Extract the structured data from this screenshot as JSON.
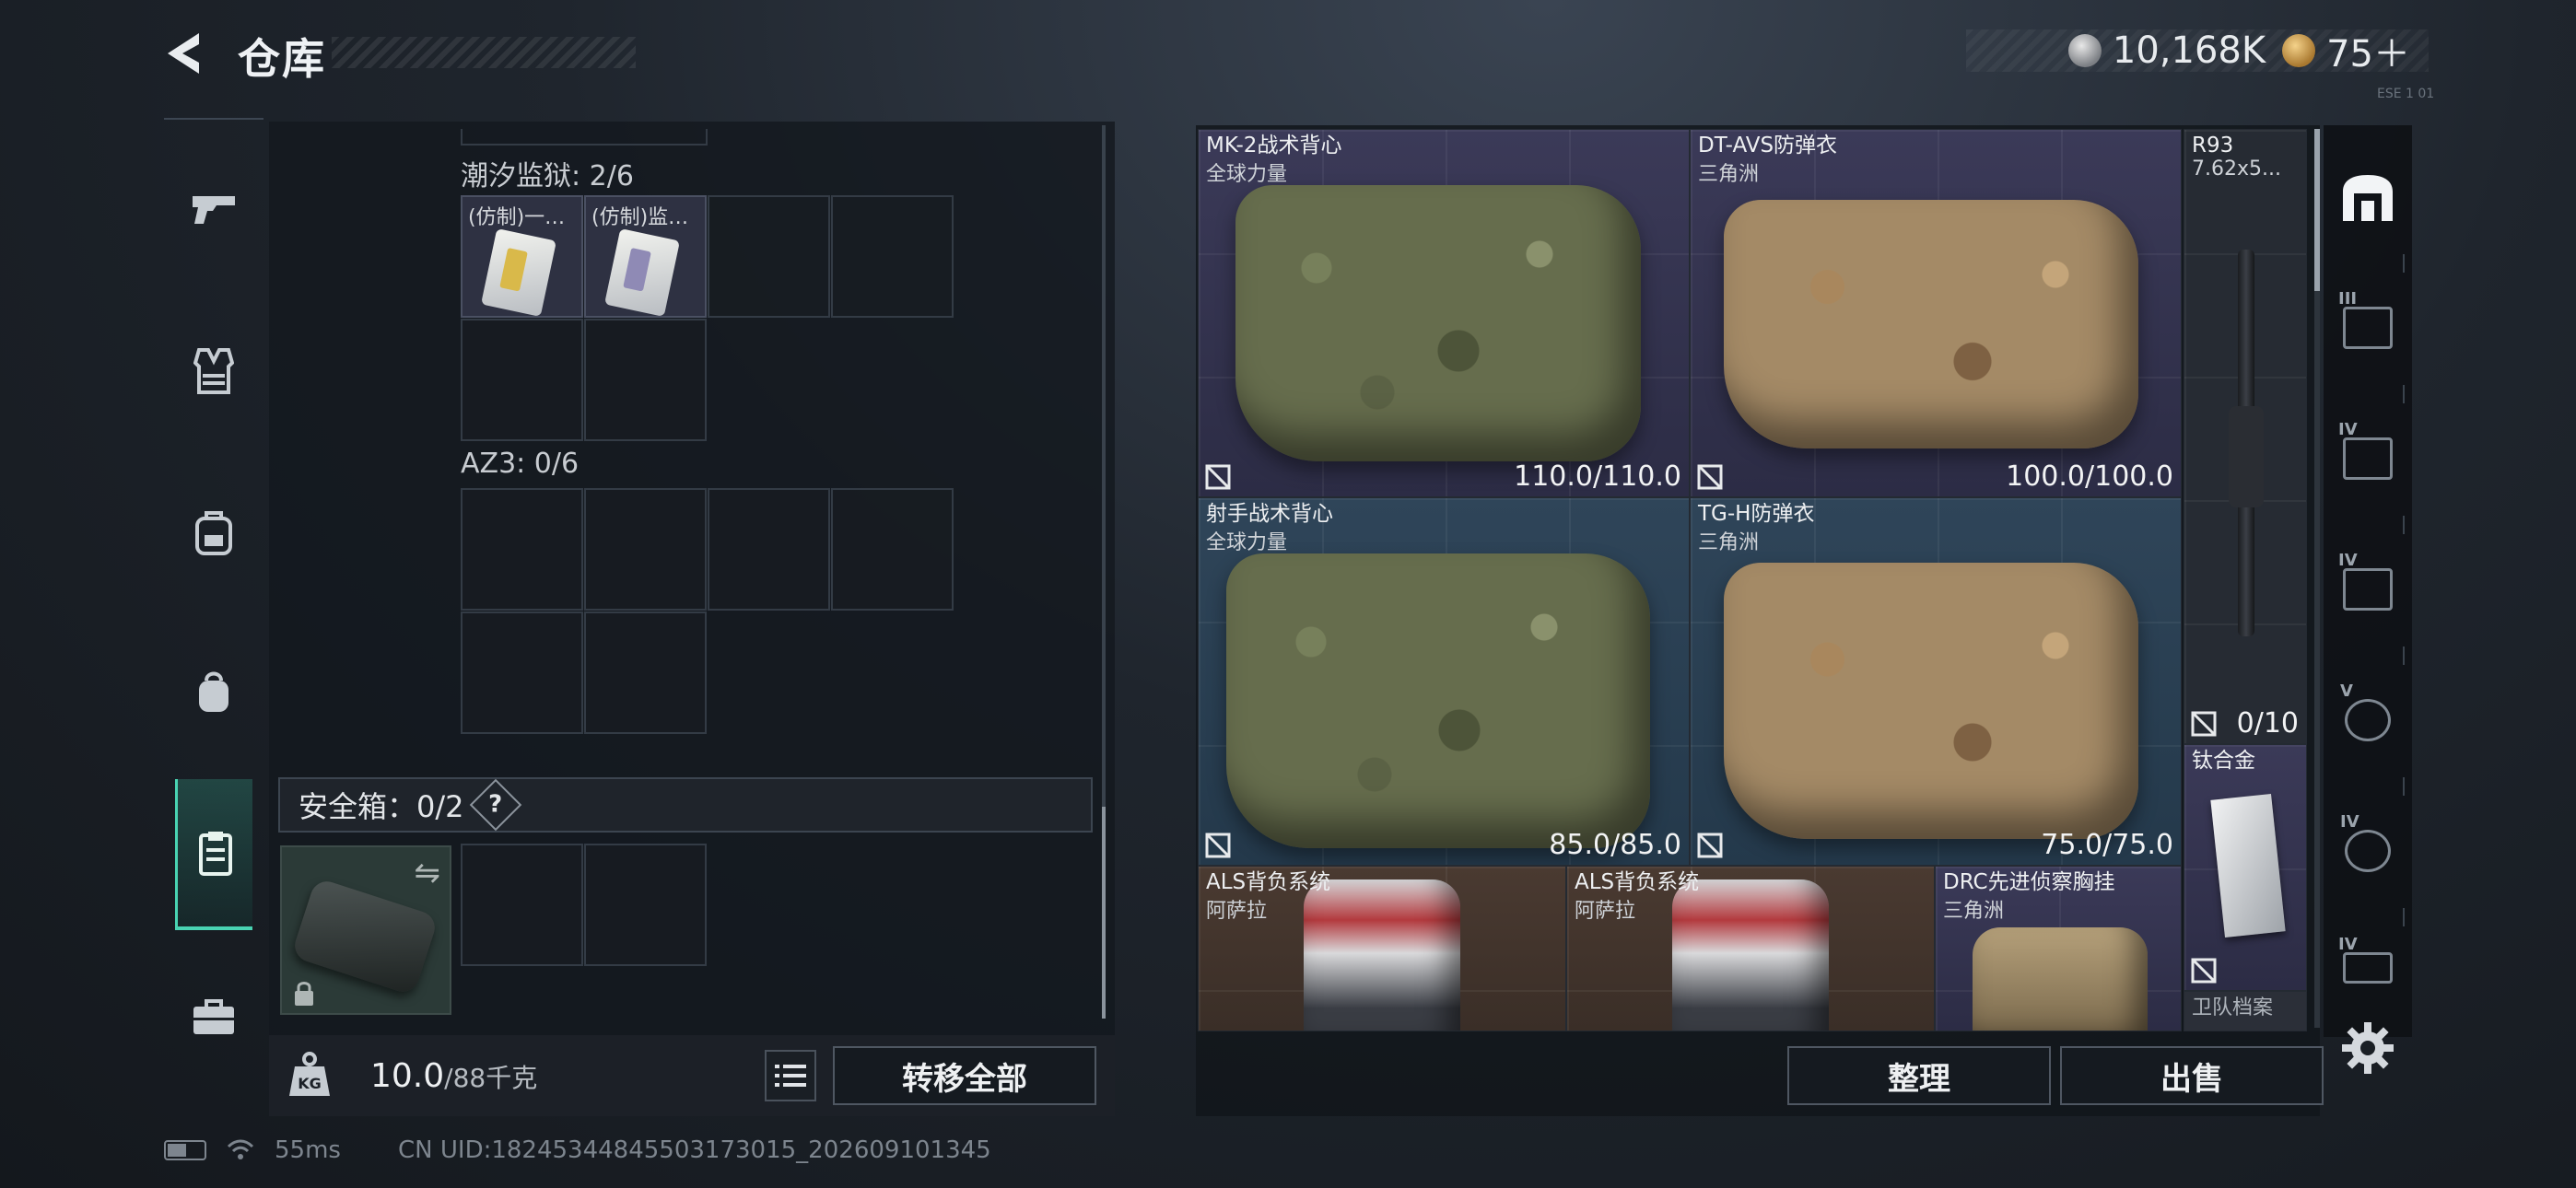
{
  "header": {
    "title": "仓库"
  },
  "currency": {
    "silver": "10,168K",
    "gold": "75＋"
  },
  "version_text": "ESE 1 01",
  "left_nav": [
    "weapons",
    "armor",
    "chest-rig",
    "backpack",
    "container",
    "toolbox"
  ],
  "containers": {
    "section1_label": "潮汐监狱: 2/6",
    "section1_items": [
      {
        "name": "(仿制)一…",
        "color": "yellow"
      },
      {
        "name": "(仿制)监…",
        "color": "purple"
      }
    ],
    "section2_label": "AZ3: 0/6",
    "safe_label": "安全箱：0/2",
    "safe_help": "?"
  },
  "capacity": {
    "current": "10.0",
    "max": "/88千克"
  },
  "buttons": {
    "transfer_all": "转移全部",
    "sort": "整理",
    "sell": "出售"
  },
  "stash": [
    {
      "name": "MK-2战术背心",
      "sub": "全球力量",
      "durability": "110.0/110.0"
    },
    {
      "name": "DT-AVS防弹衣",
      "sub": "三角洲",
      "durability": "100.0/100.0"
    },
    {
      "name": "R93",
      "sub": "7.62x5...",
      "durability": "0/10"
    },
    {
      "name": "射手战术背心",
      "sub": "全球力量",
      "durability": "85.0/85.0"
    },
    {
      "name": "TG-H防弹衣",
      "sub": "三角洲",
      "durability": "75.0/75.0"
    },
    {
      "name": "钛合金",
      "sub": ""
    },
    {
      "name": "ALS背负系统",
      "sub": "阿萨拉"
    },
    {
      "name": "ALS背负系统",
      "sub": "阿萨拉"
    },
    {
      "name": "DRC先进侦察胸挂",
      "sub": "三角洲"
    },
    {
      "name": "卫队档案",
      "sub": ""
    }
  ],
  "filters": [
    "",
    "III",
    "IV",
    "IV",
    "V",
    "IV",
    "IV"
  ],
  "status": {
    "ping": "55ms",
    "uid": "CN UID:18245344845503173015_202609101345"
  }
}
